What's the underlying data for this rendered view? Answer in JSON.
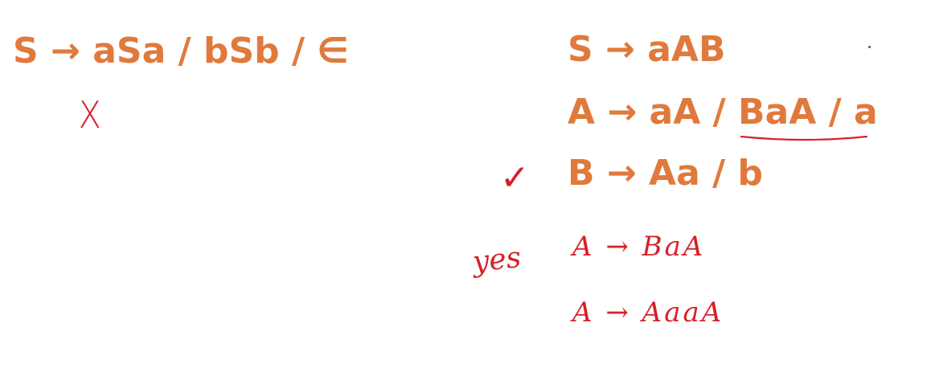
{
  "grammar1": {
    "rule": "S → aSa / bSb / ∈"
  },
  "grammar2": {
    "rules": [
      "S → aAB",
      "A → aA / BaA / a",
      "B → Aa / b"
    ]
  },
  "annotations": {
    "cross_mark": "X",
    "check_mark": "✓",
    "answer": "yes",
    "derivation": [
      "A → BaA",
      "A → AaaA"
    ]
  },
  "colors": {
    "rule_text": "#e07a3c",
    "handwriting": "#d6202a"
  }
}
